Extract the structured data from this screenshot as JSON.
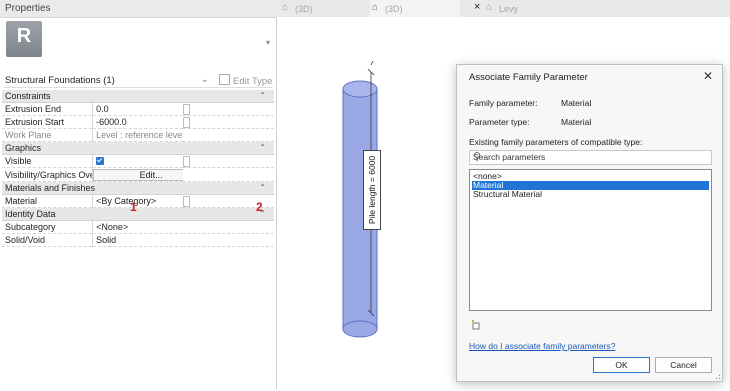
{
  "properties": {
    "title": "Properties",
    "thumbnail_letter": "R",
    "type_selector": "Structural Foundations (1)",
    "edit_type_label": "Edit Type",
    "groups": [
      {
        "name": "Constraints",
        "rows": [
          {
            "label": "Extrusion End",
            "value": "0.0"
          },
          {
            "label": "Extrusion Start",
            "value": "-6000.0"
          },
          {
            "label": "Work Plane",
            "value": "Level : reference level"
          }
        ]
      },
      {
        "name": "Graphics",
        "rows": [
          {
            "label": "Visible",
            "value": ""
          },
          {
            "label": "Visibility/Graphics Overrides",
            "value": "Edit..."
          }
        ]
      },
      {
        "name": "Materials and Finishes",
        "rows": [
          {
            "label": "Material",
            "value": "<By Category>"
          }
        ]
      },
      {
        "name": "Identity Data",
        "rows": [
          {
            "label": "Subcategory",
            "value": "<None>"
          },
          {
            "label": "Solid/Void",
            "value": "Solid"
          }
        ]
      }
    ],
    "markers": [
      "1",
      "2"
    ]
  },
  "tabs": [
    {
      "label": "(3D)"
    },
    {
      "label": "(3D)"
    },
    {
      "label": "Levy"
    }
  ],
  "viewport": {
    "dimension_label": "Pile length = 6000",
    "cylinder_color": "#9aa8e6"
  },
  "dialog": {
    "title": "Associate Family Parameter",
    "family_parameter_label": "Family parameter:",
    "family_parameter_value": "Material",
    "parameter_type_label": "Parameter type:",
    "parameter_type_value": "Material",
    "existing_label": "Existing family parameters of compatible type:",
    "search_placeholder": "Search parameters",
    "options": [
      "<none>",
      "Material",
      "Structural Material"
    ],
    "selected_option": "Material",
    "help_link": "How do I associate family parameters?",
    "ok_label": "OK",
    "cancel_label": "Cancel"
  }
}
